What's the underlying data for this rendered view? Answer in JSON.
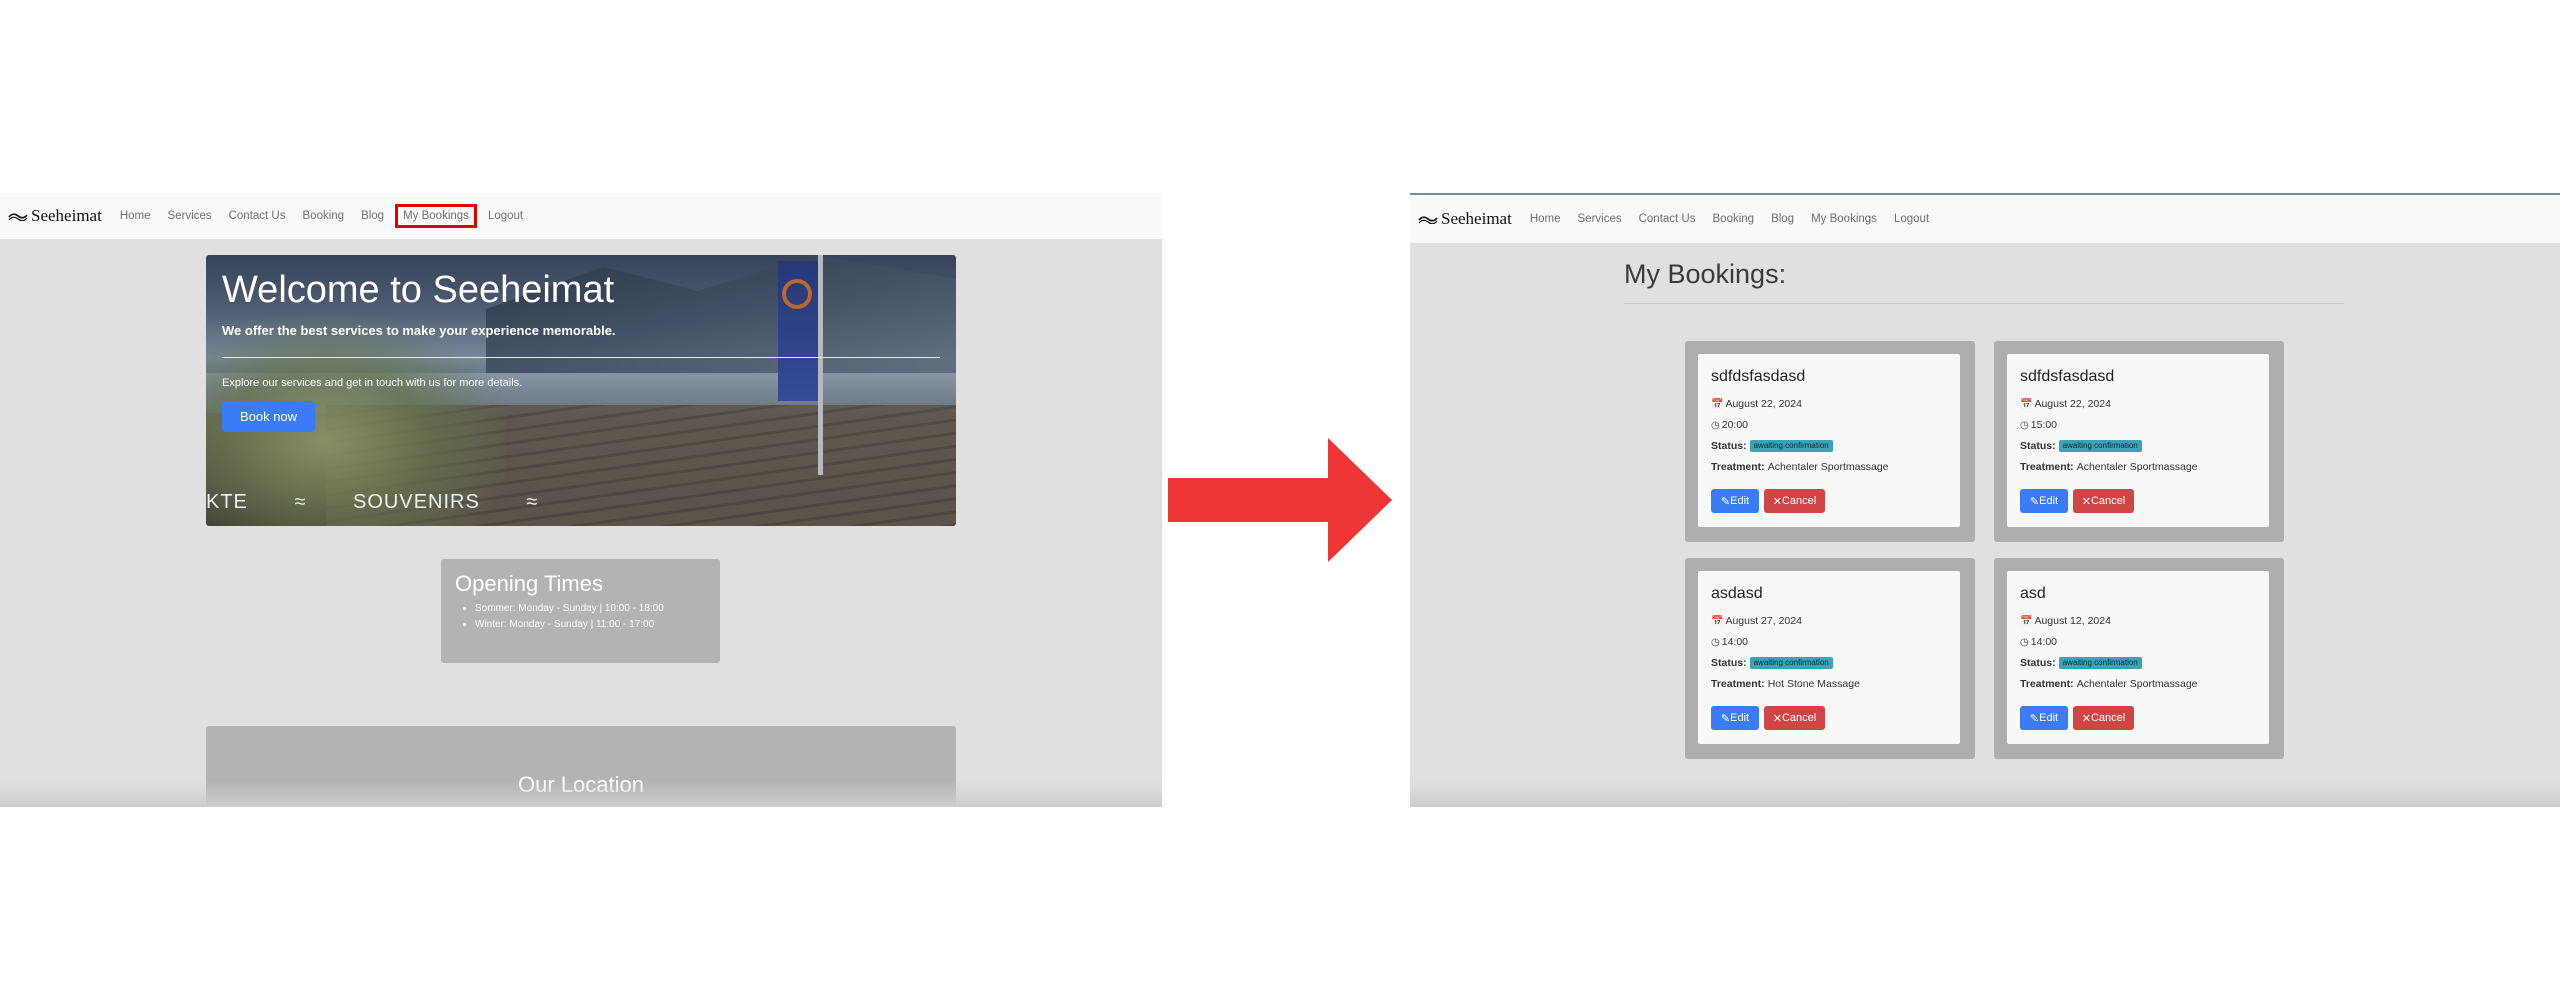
{
  "left": {
    "brand": "Seeheimat",
    "nav": [
      "Home",
      "Services",
      "Contact Us",
      "Booking",
      "Blog",
      "My Bookings",
      "Logout"
    ],
    "highlighted_nav": "My Bookings",
    "hero": {
      "title": "Welcome to Seeheimat",
      "subtitle": "We offer the best services to make your experience memorable.",
      "lead": "Explore our services and get in touch with us for more details.",
      "button": "Book now",
      "marquee": [
        "KTE",
        "≈",
        "SOUVENIRS",
        "≈"
      ]
    },
    "opening": {
      "title": "Opening Times",
      "items": [
        "Sommer: Monday - Sunday | 10:00 - 18:00",
        "Winter: Monday - Sunday | 11:00 - 17:00"
      ]
    },
    "location": {
      "title": "Our Location"
    }
  },
  "right": {
    "brand": "Seeheimat",
    "nav": [
      "Home",
      "Services",
      "Contact Us",
      "Booking",
      "Blog",
      "My Bookings",
      "Logout"
    ],
    "page_title": "My Bookings:",
    "labels": {
      "status": "Status:",
      "treatment": "Treatment:",
      "edit": "Edit",
      "cancel": "Cancel"
    },
    "bookings": [
      {
        "name": "sdfdsfasdasd",
        "date": "August 22, 2024",
        "time": "20:00",
        "status": "awaiting confirmation",
        "treatment": "Achentaler Sportmassage"
      },
      {
        "name": "sdfdsfasdasd",
        "date": "August 22, 2024",
        "time": "15:00",
        "status": "awaiting confirmation",
        "treatment": "Achentaler Sportmassage"
      },
      {
        "name": "asdasd",
        "date": "August 27, 2024",
        "time": "14:00",
        "status": "awaiting confirmation",
        "treatment": "Hot Stone Massage"
      },
      {
        "name": "asd",
        "date": "August 12, 2024",
        "time": "14:00",
        "status": "awaiting confirmation",
        "treatment": "Achentaler Sportmassage"
      }
    ]
  },
  "colors": {
    "arrow": "#ee3535",
    "primary": "#3b7cf6",
    "danger": "#d04545",
    "badge": "#3aa3b8",
    "highlight": "#e00000"
  },
  "icons": {
    "arrow": "right-arrow-icon",
    "calendar": "calendar-icon",
    "clock": "clock-icon",
    "edit": "edit-icon",
    "cancel": "x-icon",
    "logo": "wave-logo-icon"
  }
}
